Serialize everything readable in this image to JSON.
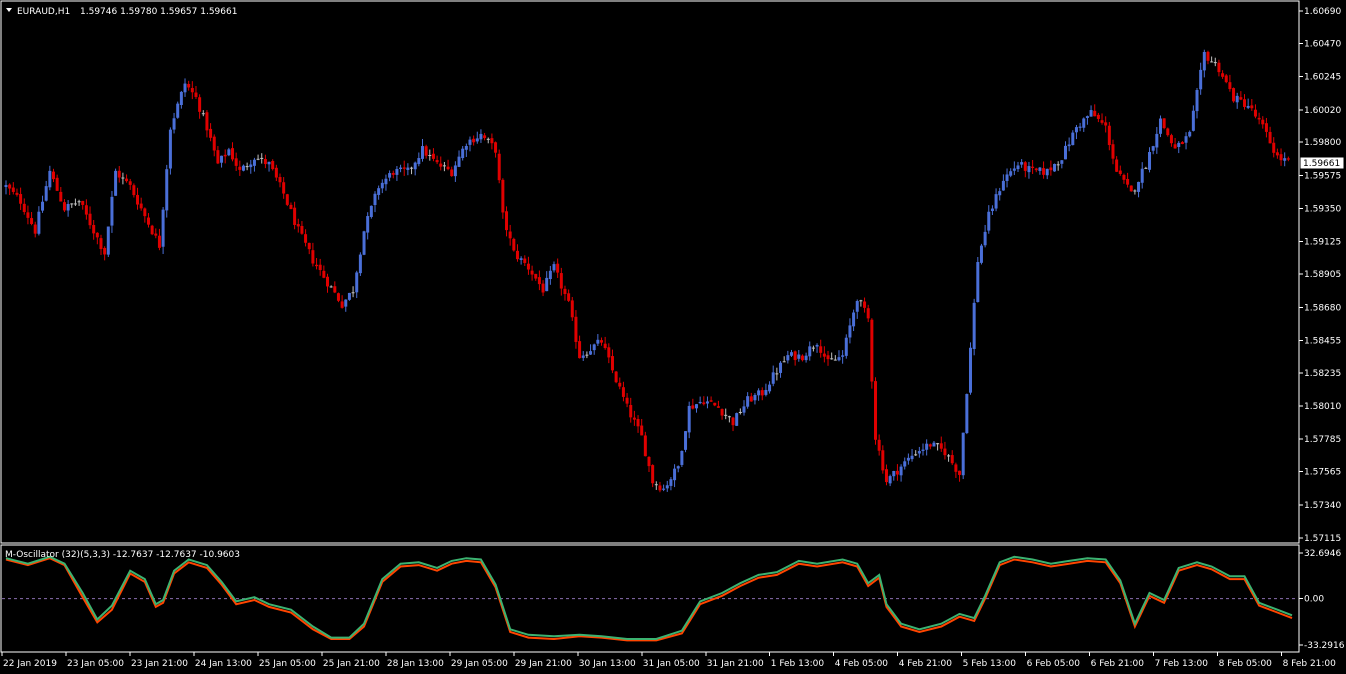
{
  "chart_data": [
    {
      "type": "candlestick",
      "symbol": "EURAUD,H1",
      "header_values": "1.59746 1.59780 1.59657 1.59661",
      "current_price": "1.59661",
      "ylim": [
        1.57115,
        1.6069
      ],
      "y_ticks": [
        "1.60690",
        "1.60470",
        "1.60245",
        "1.60020",
        "1.59800",
        "1.59575",
        "1.59350",
        "1.59125",
        "1.58905",
        "1.58680",
        "1.58455",
        "1.58235",
        "1.58010",
        "1.57785",
        "1.57565",
        "1.57340",
        "1.57115"
      ],
      "x_tick_labels": [
        "22 Jan 2019",
        "23 Jan 05:00",
        "23 Jan 21:00",
        "24 Jan 13:00",
        "25 Jan 05:00",
        "25 Jan 21:00",
        "28 Jan 13:00",
        "29 Jan 05:00",
        "29 Jan 21:00",
        "30 Jan 13:00",
        "31 Jan 05:00",
        "31 Jan 21:00",
        "1 Feb 13:00",
        "4 Feb 05:00",
        "4 Feb 21:00",
        "5 Feb 13:00",
        "6 Feb 05:00",
        "6 Feb 21:00",
        "7 Feb 13:00",
        "8 Feb 05:00",
        "8 Feb 21:00"
      ],
      "candle_colors": {
        "up": "#4a6fd8",
        "down": "#e00000",
        "neutral": "#c0c0c0"
      },
      "close_path": [
        [
          0,
          1.595
        ],
        [
          4,
          1.594
        ],
        [
          8,
          1.592
        ],
        [
          12,
          1.596
        ],
        [
          16,
          1.5935
        ],
        [
          20,
          1.594
        ],
        [
          24,
          1.592
        ],
        [
          27,
          1.5905
        ],
        [
          30,
          1.596
        ],
        [
          34,
          1.595
        ],
        [
          38,
          1.593
        ],
        [
          42,
          1.591
        ],
        [
          45,
          1.599
        ],
        [
          49,
          1.602
        ],
        [
          52,
          1.601
        ],
        [
          55,
          1.599
        ],
        [
          58,
          1.5965
        ],
        [
          61,
          1.5975
        ],
        [
          64,
          1.596
        ],
        [
          68,
          1.597
        ],
        [
          72,
          1.5965
        ],
        [
          76,
          1.5945
        ],
        [
          80,
          1.592
        ],
        [
          84,
          1.59
        ],
        [
          88,
          1.5885
        ],
        [
          92,
          1.587
        ],
        [
          95,
          1.588
        ],
        [
          98,
          1.592
        ],
        [
          102,
          1.595
        ],
        [
          106,
          1.596
        ],
        [
          110,
          1.596
        ],
        [
          114,
          1.5975
        ],
        [
          118,
          1.5965
        ],
        [
          122,
          1.596
        ],
        [
          126,
          1.598
        ],
        [
          130,
          1.5985
        ],
        [
          134,
          1.5975
        ],
        [
          136,
          1.593
        ],
        [
          139,
          1.5905
        ],
        [
          143,
          1.5895
        ],
        [
          147,
          1.588
        ],
        [
          150,
          1.5895
        ],
        [
          154,
          1.587
        ],
        [
          157,
          1.5835
        ],
        [
          160,
          1.584
        ],
        [
          163,
          1.5845
        ],
        [
          166,
          1.5825
        ],
        [
          170,
          1.58
        ],
        [
          174,
          1.578
        ],
        [
          177,
          1.575
        ],
        [
          180,
          1.5745
        ],
        [
          184,
          1.576
        ],
        [
          187,
          1.58
        ],
        [
          191,
          1.5805
        ],
        [
          195,
          1.58
        ],
        [
          199,
          1.579
        ],
        [
          203,
          1.5805
        ],
        [
          207,
          1.581
        ],
        [
          211,
          1.5825
        ],
        [
          214,
          1.5835
        ],
        [
          218,
          1.5835
        ],
        [
          222,
          1.5845
        ],
        [
          225,
          1.583
        ],
        [
          229,
          1.5835
        ],
        [
          233,
          1.5875
        ],
        [
          236,
          1.586
        ],
        [
          238,
          1.578
        ],
        [
          241,
          1.575
        ],
        [
          245,
          1.576
        ],
        [
          249,
          1.577
        ],
        [
          253,
          1.5775
        ],
        [
          257,
          1.577
        ],
        [
          261,
          1.5755
        ],
        [
          264,
          1.584
        ],
        [
          266,
          1.59
        ],
        [
          269,
          1.593
        ],
        [
          273,
          1.5955
        ],
        [
          277,
          1.5965
        ],
        [
          281,
          1.596
        ],
        [
          285,
          1.596
        ],
        [
          289,
          1.597
        ],
        [
          293,
          1.599
        ],
        [
          297,
          1.6
        ],
        [
          301,
          1.599
        ],
        [
          304,
          1.596
        ],
        [
          308,
          1.5945
        ],
        [
          312,
          1.5965
        ],
        [
          316,
          1.5995
        ],
        [
          320,
          1.5975
        ],
        [
          324,
          1.5985
        ],
        [
          328,
          1.604
        ],
        [
          332,
          1.603
        ],
        [
          336,
          1.601
        ],
        [
          340,
          1.6005
        ],
        [
          344,
          1.599
        ],
        [
          348,
          1.597
        ],
        [
          352,
          1.5965
        ]
      ],
      "n_candles": 352
    },
    {
      "type": "line",
      "indicator_label": "M-Oscillator (32)(5,3,3) -12.7637 -12.7637 -10.9603",
      "ylim": [
        -33.2916,
        32.6946
      ],
      "y_ticks": [
        "32.6946",
        "0.00",
        "-33.2916"
      ],
      "zero_line": true,
      "series": [
        {
          "color": "#ff4500",
          "values": [
            [
              0,
              28
            ],
            [
              6,
              24
            ],
            [
              12,
              29
            ],
            [
              16,
              24
            ],
            [
              21,
              1
            ],
            [
              25,
              -17
            ],
            [
              29,
              -8
            ],
            [
              34,
              18
            ],
            [
              38,
              12
            ],
            [
              41,
              -6
            ],
            [
              43,
              -3
            ],
            [
              46,
              18
            ],
            [
              50,
              26
            ],
            [
              55,
              22
            ],
            [
              59,
              10
            ],
            [
              63,
              -4
            ],
            [
              68,
              -1
            ],
            [
              72,
              -6
            ],
            [
              78,
              -10
            ],
            [
              84,
              -22
            ],
            [
              89,
              -29
            ],
            [
              94,
              -29
            ],
            [
              98,
              -20
            ],
            [
              103,
              12
            ],
            [
              108,
              23
            ],
            [
              113,
              24
            ],
            [
              118,
              20
            ],
            [
              122,
              25
            ],
            [
              126,
              27
            ],
            [
              130,
              26
            ],
            [
              134,
              8
            ],
            [
              138,
              -24
            ],
            [
              143,
              -28
            ],
            [
              150,
              -29
            ],
            [
              157,
              -27
            ],
            [
              163,
              -28
            ],
            [
              170,
              -30
            ],
            [
              178,
              -30
            ],
            [
              185,
              -25
            ],
            [
              190,
              -4
            ],
            [
              196,
              2
            ],
            [
              201,
              9
            ],
            [
              206,
              15
            ],
            [
              211,
              17
            ],
            [
              217,
              25
            ],
            [
              222,
              23
            ],
            [
              229,
              26
            ],
            [
              233,
              23
            ],
            [
              236,
              9
            ],
            [
              239,
              15
            ],
            [
              241,
              -6
            ],
            [
              245,
              -20
            ],
            [
              250,
              -24
            ],
            [
              256,
              -20
            ],
            [
              261,
              -13
            ],
            [
              265,
              -16
            ],
            [
              268,
              0
            ],
            [
              272,
              24
            ],
            [
              276,
              28
            ],
            [
              281,
              26
            ],
            [
              286,
              23
            ],
            [
              291,
              25
            ],
            [
              296,
              27
            ],
            [
              301,
              26
            ],
            [
              305,
              11
            ],
            [
              309,
              -20
            ],
            [
              313,
              2
            ],
            [
              317,
              -3
            ],
            [
              321,
              20
            ],
            [
              326,
              24
            ],
            [
              330,
              21
            ],
            [
              335,
              14
            ],
            [
              339,
              14
            ],
            [
              343,
              -5
            ],
            [
              348,
              -10
            ],
            [
              352,
              -14
            ]
          ]
        },
        {
          "color": "#3cb371",
          "values": [
            [
              0,
              29
            ],
            [
              6,
              25
            ],
            [
              12,
              30
            ],
            [
              16,
              25
            ],
            [
              21,
              4
            ],
            [
              25,
              -15
            ],
            [
              29,
              -5
            ],
            [
              34,
              20
            ],
            [
              38,
              14
            ],
            [
              41,
              -4
            ],
            [
              43,
              -1
            ],
            [
              46,
              20
            ],
            [
              50,
              28
            ],
            [
              55,
              24
            ],
            [
              59,
              12
            ],
            [
              63,
              -2
            ],
            [
              68,
              1
            ],
            [
              72,
              -4
            ],
            [
              78,
              -8
            ],
            [
              84,
              -20
            ],
            [
              89,
              -28
            ],
            [
              94,
              -28
            ],
            [
              98,
              -18
            ],
            [
              103,
              14
            ],
            [
              108,
              25
            ],
            [
              113,
              26
            ],
            [
              118,
              22
            ],
            [
              122,
              27
            ],
            [
              126,
              29
            ],
            [
              130,
              28
            ],
            [
              134,
              10
            ],
            [
              138,
              -22
            ],
            [
              143,
              -26
            ],
            [
              150,
              -27
            ],
            [
              157,
              -26
            ],
            [
              163,
              -27
            ],
            [
              170,
              -29
            ],
            [
              178,
              -29
            ],
            [
              185,
              -23
            ],
            [
              190,
              -2
            ],
            [
              196,
              4
            ],
            [
              201,
              11
            ],
            [
              206,
              17
            ],
            [
              211,
              19
            ],
            [
              217,
              27
            ],
            [
              222,
              25
            ],
            [
              229,
              28
            ],
            [
              233,
              25
            ],
            [
              236,
              11
            ],
            [
              239,
              17
            ],
            [
              241,
              -4
            ],
            [
              245,
              -18
            ],
            [
              250,
              -22
            ],
            [
              256,
              -18
            ],
            [
              261,
              -11
            ],
            [
              265,
              -14
            ],
            [
              268,
              2
            ],
            [
              272,
              26
            ],
            [
              276,
              30
            ],
            [
              281,
              28
            ],
            [
              286,
              25
            ],
            [
              291,
              27
            ],
            [
              296,
              29
            ],
            [
              301,
              28
            ],
            [
              305,
              13
            ],
            [
              309,
              -18
            ],
            [
              313,
              4
            ],
            [
              317,
              -1
            ],
            [
              321,
              22
            ],
            [
              326,
              26
            ],
            [
              330,
              23
            ],
            [
              335,
              16
            ],
            [
              339,
              16
            ],
            [
              343,
              -3
            ],
            [
              348,
              -8
            ],
            [
              352,
              -12
            ]
          ]
        }
      ]
    }
  ]
}
